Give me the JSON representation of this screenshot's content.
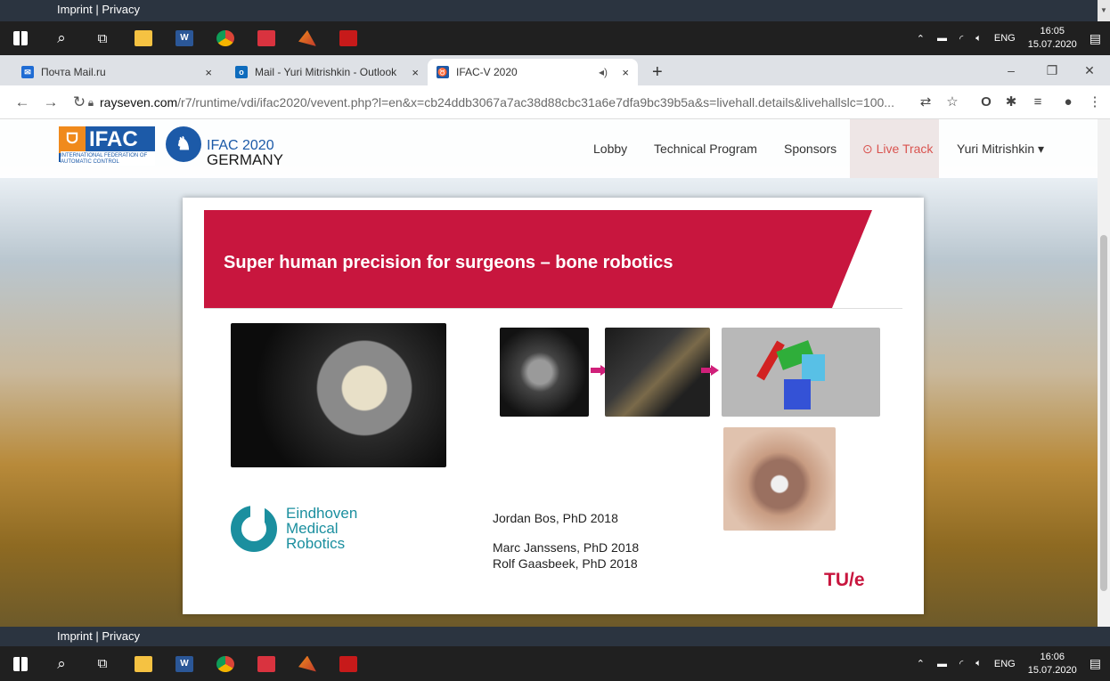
{
  "footer_top": {
    "imprint": "Imprint | Privacy"
  },
  "footer_bottom": {
    "imprint": "Imprint | Privacy"
  },
  "taskbar_top": {
    "lang": "ENG",
    "time": "16:05",
    "date": "15.07.2020"
  },
  "taskbar_bottom": {
    "lang": "ENG",
    "time": "16:06",
    "date": "15.07.2020"
  },
  "taskbar_icons": [
    "windows-start-icon",
    "search-icon",
    "task-view-icon",
    "file-explorer-icon",
    "word-icon",
    "chrome-icon",
    "mail-icon",
    "matlab-icon",
    "acrobat-icon"
  ],
  "browser": {
    "tabs": [
      {
        "label": "Почта Mail.ru",
        "fav_color": "#1f6cd4"
      },
      {
        "label": "Mail - Yuri Mitrishkin - Outlook",
        "fav_color": "#0f6cbd"
      },
      {
        "label": "IFAC-V 2020",
        "fav_color": "#1c5aa8",
        "active": true
      }
    ],
    "url_domain": "rayseven.com",
    "url_path": "/r7/runtime/vdi/ifac2020/vevent.php?l=en&x=cb24ddb3067a7ac38d88cbc31a6e7dfa9bc39b5a&s=livehall.details&livehallslc=100..."
  },
  "site": {
    "logo_text": "IFAC",
    "logo_sub": "INTERNATIONAL FEDERATION OF AUTOMATIC CONTROL",
    "congress_title": "IFAC 2020",
    "congress_country": "GERMANY",
    "nav": [
      "Lobby",
      "Technical Program",
      "Sponsors",
      "Live Track"
    ],
    "user": "Yuri Mitrishkin"
  },
  "slide": {
    "title": "Super human precision for surgeons – bone robotics",
    "org": [
      "Eindhoven",
      "Medical",
      "Robotics"
    ],
    "authors": [
      "Jordan Bos, PhD 2018",
      "Marc Janssens, PhD 2018",
      "Rolf Gaasbeek, PhD 2018"
    ],
    "university": "TU/e"
  }
}
